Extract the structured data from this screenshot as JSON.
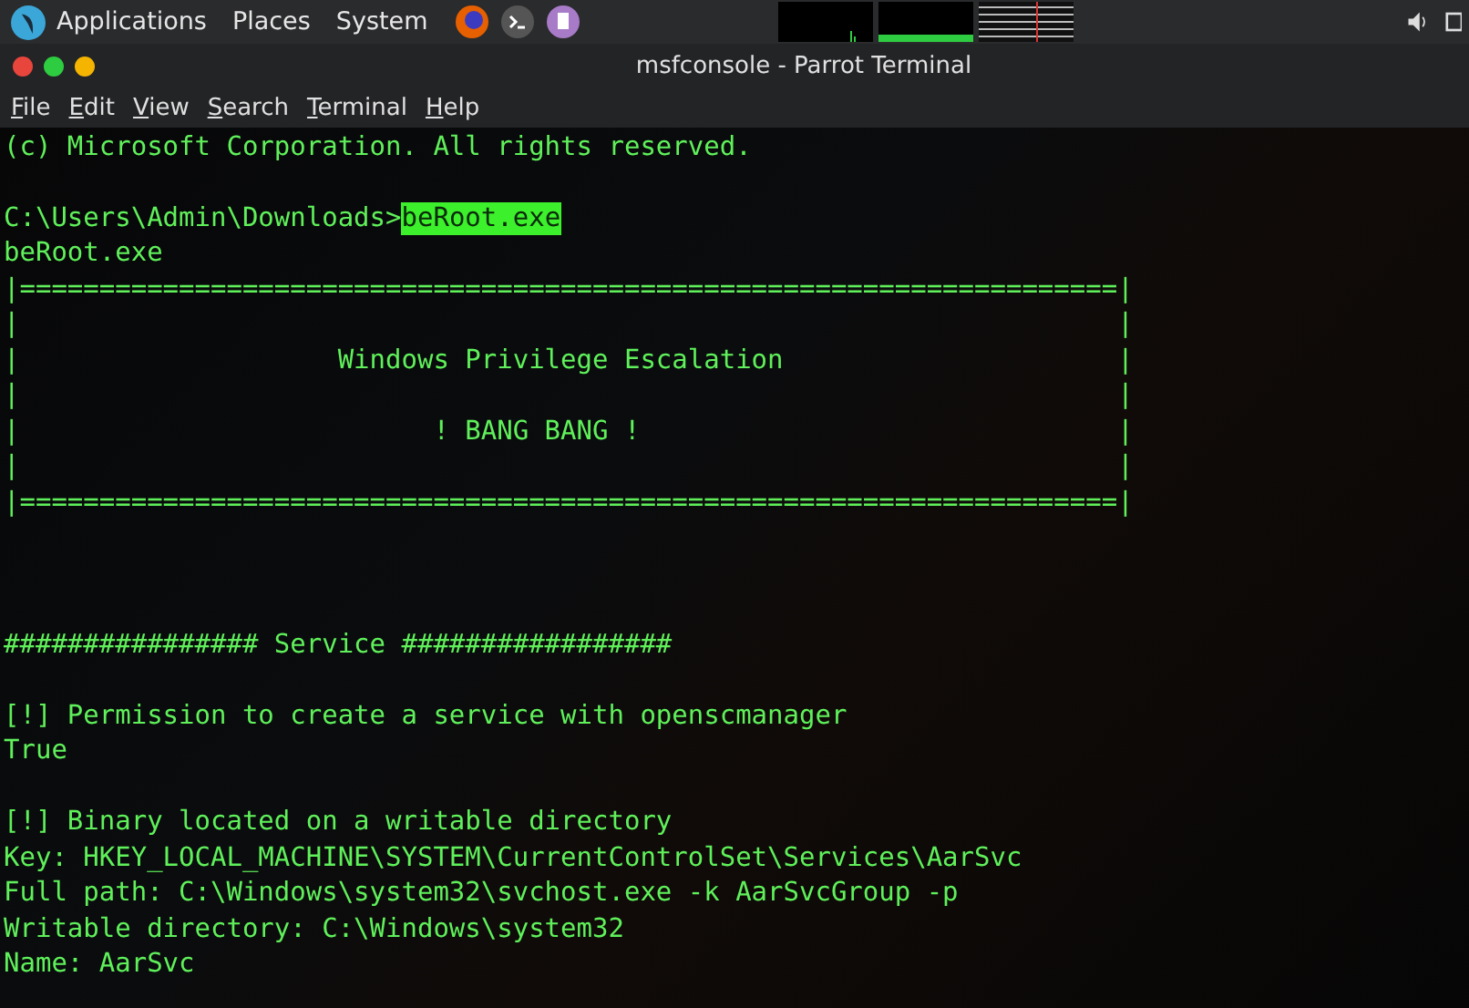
{
  "top_panel": {
    "menus": [
      "Applications",
      "Places",
      "System"
    ]
  },
  "window": {
    "title": "msfconsole - Parrot Terminal",
    "controls": [
      {
        "color": "#e8453c"
      },
      {
        "color": "#2ecc40"
      },
      {
        "color": "#f4b400"
      }
    ]
  },
  "menu_bar": [
    "File",
    "Edit",
    "View",
    "Search",
    "Terminal",
    "Help"
  ],
  "terminal_lines": [
    {
      "kind": "text",
      "text": "(c) Microsoft Corporation. All rights reserved."
    },
    {
      "kind": "blank"
    },
    {
      "kind": "prompt",
      "text": "C:\\Users\\Admin\\Downloads>",
      "command": "beRoot.exe"
    },
    {
      "kind": "text",
      "text": "beRoot.exe"
    },
    {
      "kind": "text",
      "text": "|=====================================================================|"
    },
    {
      "kind": "text",
      "text": "|                                                                     |"
    },
    {
      "kind": "text",
      "text": "|                    Windows Privilege Escalation                     |"
    },
    {
      "kind": "text",
      "text": "|                                                                     |"
    },
    {
      "kind": "text",
      "text": "|                          ! BANG BANG !                              |"
    },
    {
      "kind": "text",
      "text": "|                                                                     |"
    },
    {
      "kind": "text",
      "text": "|=====================================================================|"
    },
    {
      "kind": "blank"
    },
    {
      "kind": "blank"
    },
    {
      "kind": "blank"
    },
    {
      "kind": "text",
      "text": "################ Service #################"
    },
    {
      "kind": "blank"
    },
    {
      "kind": "text",
      "text": "[!] Permission to create a service with openscmanager"
    },
    {
      "kind": "text",
      "text": "True"
    },
    {
      "kind": "blank"
    },
    {
      "kind": "text",
      "text": "[!] Binary located on a writable directory"
    },
    {
      "kind": "text",
      "text": "Key: HKEY_LOCAL_MACHINE\\SYSTEM\\CurrentControlSet\\Services\\AarSvc"
    },
    {
      "kind": "text",
      "text": "Full path: C:\\Windows\\system32\\svchost.exe -k AarSvcGroup -p"
    },
    {
      "kind": "text",
      "text": "Writable directory: C:\\Windows\\system32"
    },
    {
      "kind": "text",
      "text": "Name: AarSvc"
    }
  ]
}
